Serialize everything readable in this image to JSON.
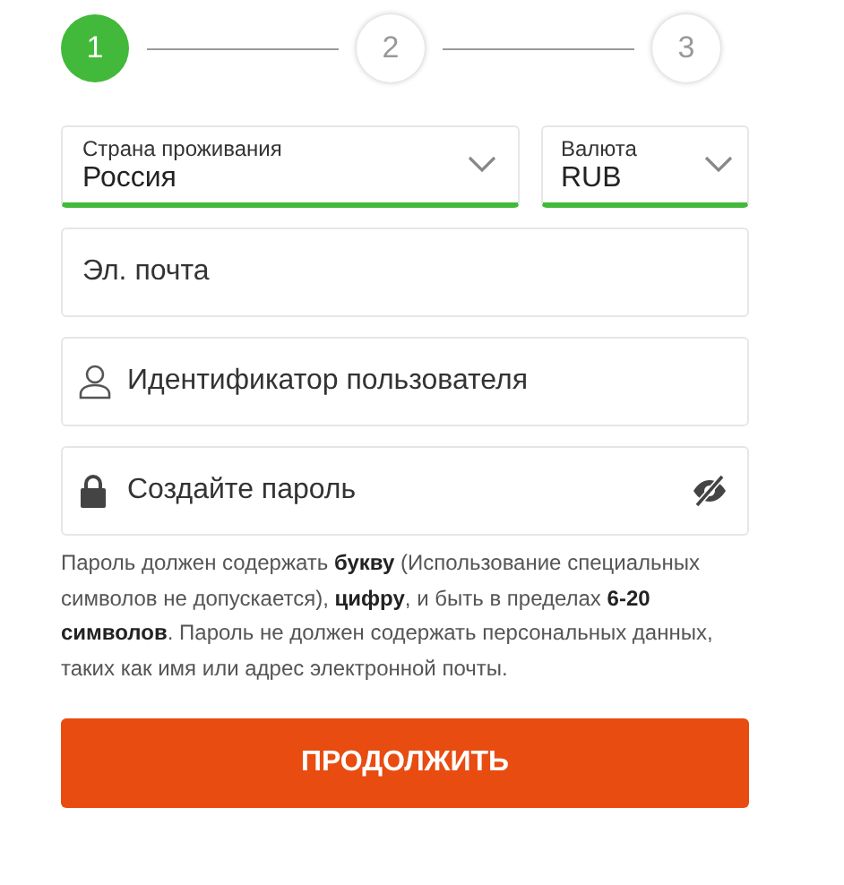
{
  "steps": [
    {
      "label": "1",
      "selected": true
    },
    {
      "label": "2",
      "selected": false
    },
    {
      "label": "3",
      "selected": false
    }
  ],
  "selects": [
    {
      "label": "Страна проживания",
      "value": "Россия"
    },
    {
      "label": "Валюта",
      "value": "RUB"
    }
  ],
  "fields": [
    {
      "kind": "email",
      "placeholder": "Эл. почта"
    },
    {
      "kind": "user",
      "placeholder": "Идентификатор пользователя"
    },
    {
      "kind": "password",
      "placeholder": "Создайте пароль"
    }
  ],
  "hint": "Пароль должен содержать **букву** (Использование специальных символов не допускается), **цифру**, и быть в пределах **6-20 символов**. Пароль не должен содержать персональных данных, таких как имя или адрес электронной почты.",
  "button": "ПРОДОЛЖИТЬ"
}
